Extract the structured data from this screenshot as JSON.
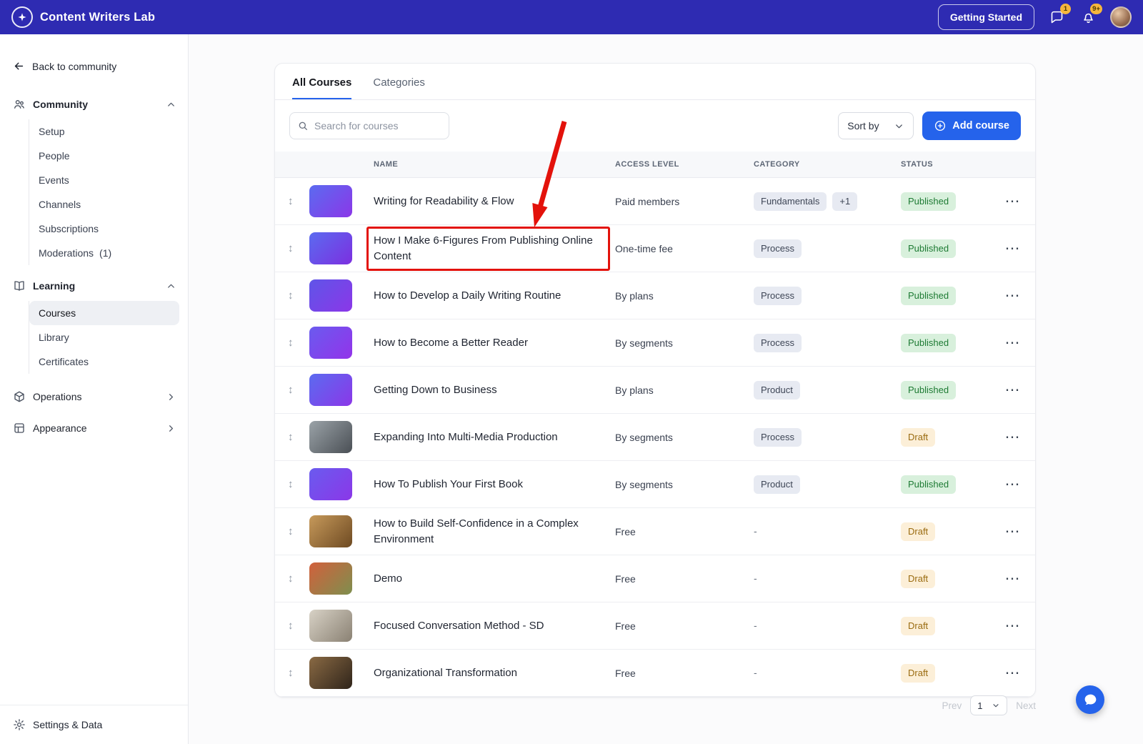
{
  "colors": {
    "topbar_bg": "#2E2BB2",
    "primary_blue": "#2563EB",
    "annotation_red": "#E3120B",
    "published_bg": "#D8F0DC",
    "published_text": "#1E7B34",
    "draft_bg": "#FCEFD8",
    "draft_text": "#9A6B10",
    "category_chip_bg": "#E7EAF2",
    "category_chip_text": "#3E4656"
  },
  "topbar": {
    "app_title": "Content Writers Lab",
    "getting_started_label": "Getting Started",
    "messages_badge": "1",
    "notifications_badge": "9+"
  },
  "sidebar": {
    "back_label": "Back to community",
    "community": {
      "label": "Community",
      "items": [
        {
          "label": "Setup"
        },
        {
          "label": "People"
        },
        {
          "label": "Events"
        },
        {
          "label": "Channels"
        },
        {
          "label": "Subscriptions"
        },
        {
          "label": "Moderations",
          "count": "(1)"
        }
      ]
    },
    "learning": {
      "label": "Learning",
      "items": [
        {
          "label": "Courses"
        },
        {
          "label": "Library"
        },
        {
          "label": "Certificates"
        }
      ]
    },
    "operations_label": "Operations",
    "appearance_label": "Appearance",
    "settings_label": "Settings & Data"
  },
  "main": {
    "tabs": {
      "all_courses": "All Courses",
      "categories": "Categories"
    },
    "search_placeholder": "Search for courses",
    "sort_by_label": "Sort by",
    "add_course_label": "Add course",
    "columns": {
      "name": "NAME",
      "access": "ACCESS LEVEL",
      "category": "CATEGORY",
      "status": "STATUS"
    },
    "empty_category": "-",
    "rows": [
      {
        "name": "Writing for Readability & Flow",
        "access": "Paid members",
        "categories": [
          "Fundamentals",
          "+1"
        ],
        "status": "Published",
        "status_type": "published",
        "thumb": [
          "#5B6BF0",
          "#8B37E8"
        ]
      },
      {
        "name": "How I Make 6-Figures From Publishing Online Content",
        "access": "One-time fee",
        "categories": [
          "Process"
        ],
        "status": "Published",
        "status_type": "published",
        "thumb": [
          "#5B6BF0",
          "#7C2FE0"
        ],
        "highlight": true
      },
      {
        "name": "How to Develop a Daily Writing Routine",
        "access": "By plans",
        "categories": [
          "Process"
        ],
        "status": "Published",
        "status_type": "published",
        "thumb": [
          "#5F55E8",
          "#8B37E8"
        ]
      },
      {
        "name": "How to Become a Better Reader",
        "access": "By segments",
        "categories": [
          "Process"
        ],
        "status": "Published",
        "status_type": "published",
        "thumb": [
          "#6A5BEF",
          "#9333EA"
        ]
      },
      {
        "name": "Getting Down to Business",
        "access": "By plans",
        "categories": [
          "Product"
        ],
        "status": "Published",
        "status_type": "published",
        "thumb": [
          "#5B6BF0",
          "#8B37E8"
        ]
      },
      {
        "name": "Expanding Into Multi-Media Production",
        "access": "By segments",
        "categories": [
          "Process"
        ],
        "status": "Draft",
        "status_type": "draft",
        "thumb": [
          "#9BA3A8",
          "#4A4F55"
        ]
      },
      {
        "name": "How To Publish Your First Book",
        "access": "By segments",
        "categories": [
          "Product"
        ],
        "status": "Published",
        "status_type": "published",
        "thumb": [
          "#6A5BEF",
          "#8B37E8"
        ]
      },
      {
        "name": "How to Build Self-Confidence in a Complex Environment",
        "access": "Free",
        "categories": [],
        "status": "Draft",
        "status_type": "draft",
        "thumb": [
          "#C79A5B",
          "#6E4A22"
        ]
      },
      {
        "name": "Demo",
        "access": "Free",
        "categories": [],
        "status": "Draft",
        "status_type": "draft",
        "thumb": [
          "#D2603C",
          "#7E8F4E"
        ]
      },
      {
        "name": "Focused Conversation Method - SD",
        "access": "Free",
        "categories": [],
        "status": "Draft",
        "status_type": "draft",
        "thumb": [
          "#D8D2C6",
          "#8A8173"
        ]
      },
      {
        "name": "Organizational Transformation",
        "access": "Free",
        "categories": [],
        "status": "Draft",
        "status_type": "draft",
        "thumb": [
          "#8A6A44",
          "#2F241A"
        ]
      }
    ],
    "pagination": {
      "prev": "Prev",
      "page": "1",
      "next": "Next"
    }
  }
}
